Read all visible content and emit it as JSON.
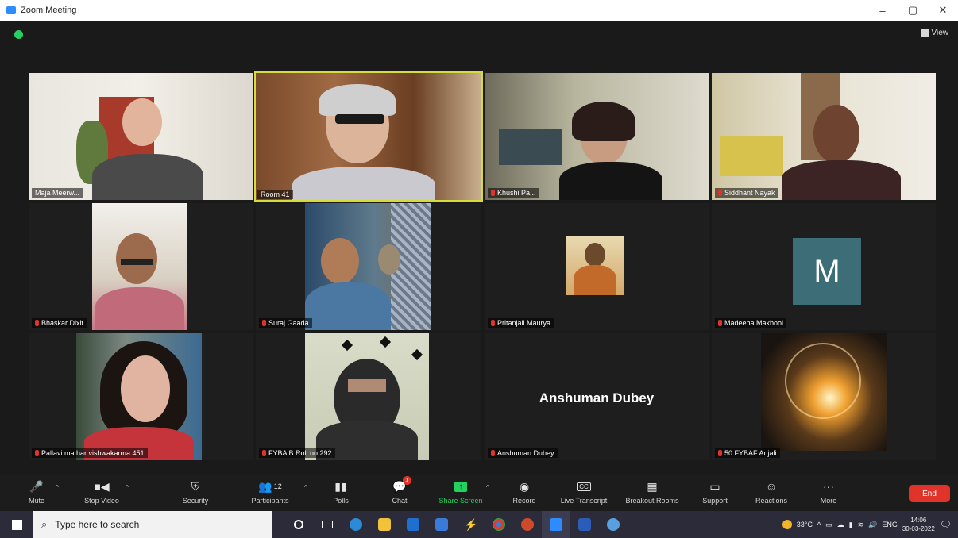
{
  "window": {
    "title": "Zoom Meeting",
    "minimize": "–",
    "maximize": "▢",
    "close": "✕"
  },
  "meeting": {
    "view_label": "View"
  },
  "tiles": [
    {
      "name": "Maja Meerw...",
      "muted": false
    },
    {
      "name": "Room 41",
      "muted": false,
      "active": true
    },
    {
      "name": "Khushi Pa...",
      "muted": true
    },
    {
      "name": "Siddhant Nayak",
      "muted": true
    },
    {
      "name": "Bhaskar Dixit",
      "muted": true
    },
    {
      "name": "Suraj Gaada",
      "muted": true
    },
    {
      "name": "Pritanjali Maurya",
      "muted": true
    },
    {
      "name": "Madeeha Makbool",
      "muted": true,
      "avatar_letter": "M"
    },
    {
      "name": "Pallavi mathar vishwakarma 451",
      "muted": true
    },
    {
      "name": "FYBA B Roll no 292",
      "muted": true
    },
    {
      "name": "Anshuman Dubey",
      "muted": true,
      "display_name": "Anshuman Dubey"
    },
    {
      "name": "50 FYBAF Anjali",
      "muted": true
    }
  ],
  "toolbar": {
    "mute": "Mute",
    "stop_video": "Stop Video",
    "security": "Security",
    "participants": "Participants",
    "participants_count": "12",
    "polls": "Polls",
    "chat": "Chat",
    "chat_badge": "1",
    "share_screen": "Share Screen",
    "record": "Record",
    "live_transcript": "Live Transcript",
    "breakout_rooms": "Breakout Rooms",
    "support": "Support",
    "reactions": "Reactions",
    "more": "More",
    "end": "End"
  },
  "taskbar": {
    "search_placeholder": "Type here to search",
    "weather": "33°C",
    "language": "ENG",
    "time": "14:06",
    "date": "30-03-2022"
  },
  "colors": {
    "accent": "#2d8cff",
    "active_speaker": "#d6dd3a",
    "end": "#e0342b",
    "share": "#23d160"
  }
}
